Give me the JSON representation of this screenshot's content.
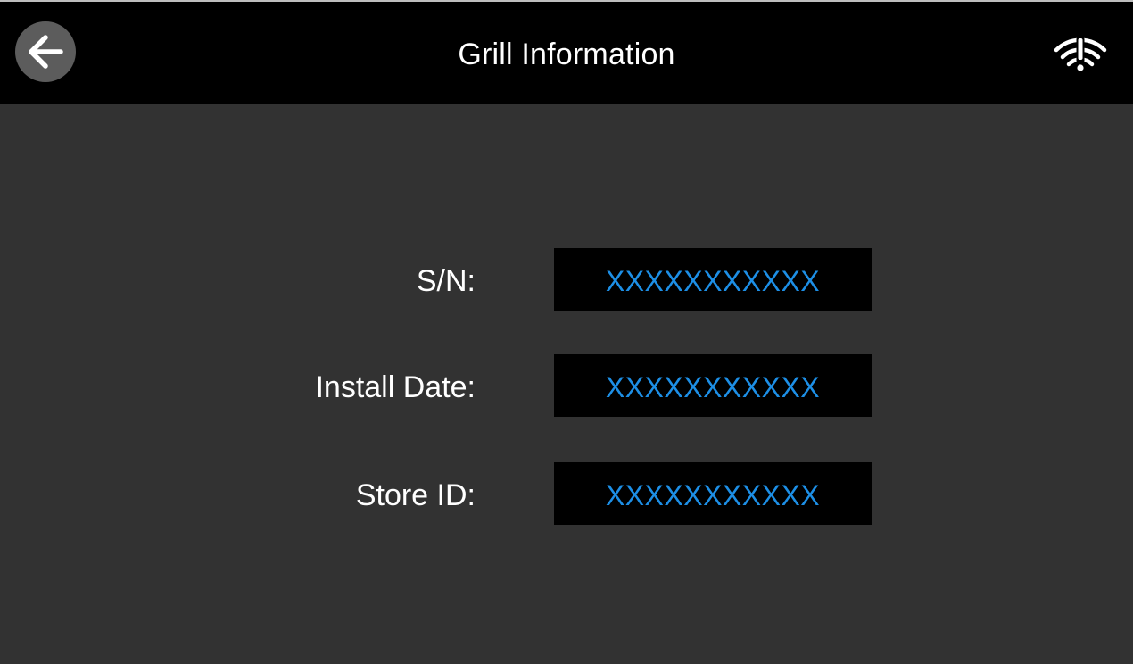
{
  "header": {
    "title": "Grill Information",
    "back_icon": "arrow-left-icon",
    "status_icon": "wifi-alert-icon"
  },
  "fields": [
    {
      "label": "S/N:",
      "value": "XXXXXXXXXXX"
    },
    {
      "label": "Install Date:",
      "value": "XXXXXXXXXXX"
    },
    {
      "label": "Store ID:",
      "value": "XXXXXXXXXXX"
    }
  ],
  "colors": {
    "background": "#323232",
    "header_background": "#000000",
    "value_text": "#1d8fe6",
    "back_button_fill": "#5c5c5c"
  }
}
